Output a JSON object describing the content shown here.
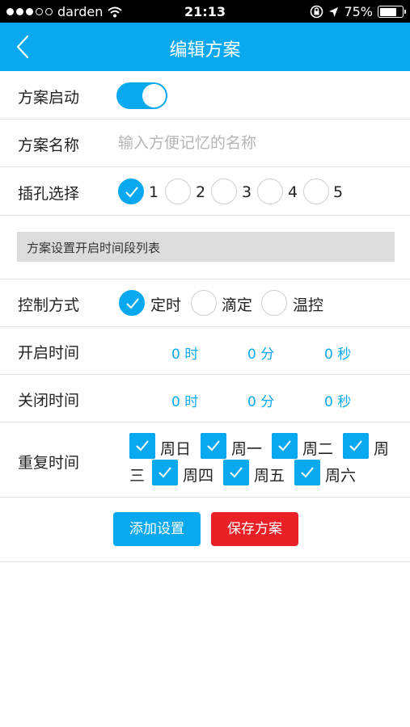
{
  "status_bar": {
    "carrier": "darden",
    "time": "21:13",
    "battery": "75%",
    "battery_level": 0.75
  },
  "nav": {
    "title": "编辑方案"
  },
  "form": {
    "enable": {
      "label": "方案启动",
      "on": true
    },
    "name": {
      "label": "方案名称",
      "placeholder": "输入方便记忆的名称",
      "value": ""
    },
    "socket": {
      "label": "插孔选择",
      "options": [
        "1",
        "2",
        "3",
        "4",
        "5"
      ],
      "selected": "1"
    },
    "section_title": "方案设置开启时间段列表",
    "control": {
      "label": "控制方式",
      "options": [
        "定时",
        "滴定",
        "温控"
      ],
      "selected": "定时"
    },
    "open_time": {
      "label": "开启时间",
      "hour": "0 时",
      "minute": "0 分",
      "second": "0 秒"
    },
    "close_time": {
      "label": "关闭时间",
      "hour": "0 时",
      "minute": "0 分",
      "second": "0 秒"
    },
    "repeat": {
      "label": "重复时间",
      "days_line1": [
        "周日",
        "周一",
        "周二"
      ],
      "wrap_start": "周",
      "wrap_end": "三",
      "days_line2": [
        "周四",
        "周五",
        "周六"
      ],
      "all_checked": true
    }
  },
  "buttons": {
    "add": "添加设置",
    "save": "保存方案"
  },
  "colors": {
    "accent": "#0aa8ef",
    "danger": "#ea2027",
    "section_bg": "#dcdcdc"
  }
}
